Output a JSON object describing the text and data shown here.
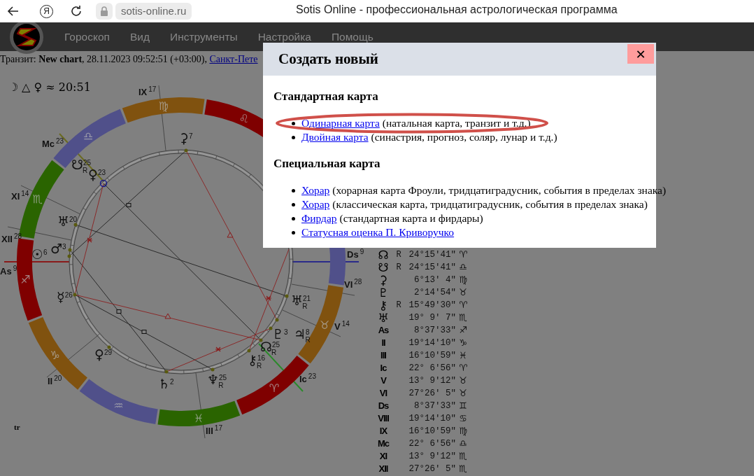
{
  "browser": {
    "yandex": "Я",
    "address": "sotis-online.ru",
    "tab_title": "Sotis Online - профессиональная астрологическая программа"
  },
  "menu": [
    {
      "label": "Гороскоп"
    },
    {
      "label": "Вид"
    },
    {
      "label": "Инструменты"
    },
    {
      "label": "Настройка"
    },
    {
      "label": "Помощь"
    }
  ],
  "transit": {
    "text": "Транзит: **New chart**, 28.11.2023 09:52:51 (+03:00), ",
    "place_link": "Санкт-Пете"
  },
  "chart": {
    "aspect_note": "☽ △ ♀ ≈ 20:51",
    "footer": "tr",
    "signs": [
      {
        "glyph": "♌",
        "color": "#7f0000"
      },
      {
        "glyph": "♍",
        "color": "#80520f"
      },
      {
        "glyph": "♎",
        "color": "#50508a"
      },
      {
        "glyph": "♏",
        "color": "#2a6400"
      },
      {
        "glyph": "♐",
        "color": "#7f0000"
      },
      {
        "glyph": "♑",
        "color": "#80520f"
      },
      {
        "glyph": "♒",
        "color": "#50508a"
      },
      {
        "glyph": "♓",
        "color": "#2a6400"
      },
      {
        "glyph": "♈",
        "color": "#7f0000"
      },
      {
        "glyph": "♉",
        "color": "#80520f"
      },
      {
        "color": "#50508a"
      }
    ],
    "cusps": [
      {
        "label": "IX",
        "degree": "17"
      },
      {
        "label": "Mc",
        "degree": "23"
      },
      {
        "label": "XI",
        "degree": "14"
      },
      {
        "label": "XII",
        "degree": "28"
      },
      {
        "label": "As",
        "degree": "9"
      },
      {
        "label": "II",
        "degree": "20"
      },
      {
        "label": "III",
        "degree": "17"
      },
      {
        "label": "Ic",
        "degree": "23"
      },
      {
        "label": "V",
        "degree": "14"
      },
      {
        "label": "VI",
        "degree": "28"
      },
      {
        "label": "Ds",
        "degree": "9"
      }
    ],
    "planets": [
      {
        "glyph": "⚳",
        "degree": "7"
      },
      {
        "glyph": "☋",
        "degree": "25",
        "retro": "R"
      },
      {
        "glyph": "♀",
        "degree": "23"
      },
      {
        "glyph": "♅",
        "degree": "20"
      },
      {
        "glyph": "♂",
        "degree": "3"
      },
      {
        "glyph": "☉",
        "degree": "6"
      },
      {
        "glyph": "☿",
        "degree": "26"
      },
      {
        "glyph": "♀",
        "degree": "29"
      },
      {
        "glyph": "♄",
        "degree": "2"
      },
      {
        "glyph": "♆",
        "degree": "25",
        "retro": "R"
      },
      {
        "glyph": "⚷",
        "degree": "16",
        "retro": "R"
      },
      {
        "glyph": "☊",
        "degree": "25",
        "retro": "R"
      },
      {
        "glyph": "♇",
        "degree": "3"
      },
      {
        "glyph": "♃",
        "degree": "8",
        "retro": "R"
      },
      {
        "glyph": "♅",
        "degree": "21",
        "retro": "R"
      }
    ]
  },
  "positions": [
    {
      "kind": "planet",
      "glyph": "☊",
      "retro": "R",
      "value": "24°15′41″",
      "sign": "♈"
    },
    {
      "kind": "planet",
      "glyph": "☋",
      "retro": "R",
      "value": "24°15′41″",
      "sign": "♎"
    },
    {
      "kind": "planet",
      "glyph": "⚳",
      "value": "6°13′ 4″",
      "sign": "♍"
    },
    {
      "kind": "planet",
      "glyph": "♇",
      "value": "2°14′54″",
      "sign": "♉"
    },
    {
      "kind": "planet",
      "glyph": "⚷",
      "retro": "R",
      "value": "15°49′30″",
      "sign": "♈"
    },
    {
      "kind": "planet",
      "glyph": "♅",
      "value": "19° 9′ 7″",
      "sign": "♏"
    },
    {
      "kind": "cusp",
      "glyph": "As",
      "value": "8°37′33″",
      "sign": "♐"
    },
    {
      "kind": "cusp",
      "glyph": "II",
      "value": "19°14′10″",
      "sign": "♑"
    },
    {
      "kind": "cusp",
      "glyph": "III",
      "value": "16°10′59″",
      "sign": "♓"
    },
    {
      "kind": "cusp",
      "glyph": "Ic",
      "value": "22° 6′56″",
      "sign": "♈"
    },
    {
      "kind": "cusp",
      "glyph": "V",
      "value": "13° 9′12″",
      "sign": "♉"
    },
    {
      "kind": "cusp",
      "glyph": "VI",
      "value": "27°26′ 5″",
      "sign": "♉"
    },
    {
      "kind": "cusp",
      "glyph": "Ds",
      "value": "8°37′33″",
      "sign": "♊"
    },
    {
      "kind": "cusp",
      "glyph": "VIII",
      "value": "19°14′10″",
      "sign": "♋"
    },
    {
      "kind": "cusp",
      "glyph": "IX",
      "value": "16°10′59″",
      "sign": "♍"
    },
    {
      "kind": "cusp",
      "glyph": "Mc",
      "value": "22° 6′56″",
      "sign": "♎"
    },
    {
      "kind": "cusp",
      "glyph": "XI",
      "value": "13° 9′12″",
      "sign": "♏"
    },
    {
      "kind": "cusp",
      "glyph": "XII",
      "value": "27°26′ 5″",
      "sign": "♏"
    }
  ],
  "dialog": {
    "title": "Создать новый",
    "close": "✕",
    "sections": [
      {
        "heading": "Стандартная карта",
        "items": [
          {
            "link": "Одинарная карта",
            "note": "(натальная карта, транзит и т.д.)",
            "highlighted": true
          },
          {
            "link": "Двойная карта",
            "note": "(синастрия, прогноз, соляр, лунар и т.д.)",
            "highlighted": false
          }
        ]
      },
      {
        "heading": "Специальная карта",
        "items": [
          {
            "link": "Хорар",
            "note": "(хорарная карта Фроули, тридцатиградусник, события в пределах знака)",
            "highlighted": false
          },
          {
            "link": "Хорар",
            "note": "(классическая карта, тридцатиградусник, события в пределах знака)",
            "highlighted": false
          },
          {
            "link": "Фирдар",
            "note": "(стандартная карта и фирдары)",
            "highlighted": false
          },
          {
            "link": "Статусная оценка П. Криворучко",
            "highlighted": false
          }
        ]
      }
    ]
  }
}
